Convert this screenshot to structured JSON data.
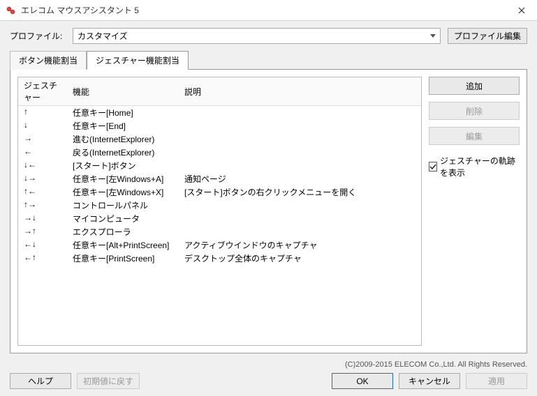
{
  "window": {
    "title": "エレコム マウスアシスタント 5"
  },
  "profile": {
    "label": "プロファイル:",
    "value": "カスタマイズ",
    "edit_button": "プロファイル編集"
  },
  "tabs": {
    "button_assign": "ボタン機能割当",
    "gesture_assign": "ジェスチャー機能割当"
  },
  "table": {
    "headers": {
      "gesture": "ジェスチャー",
      "function": "機能",
      "description": "説明"
    },
    "rows": [
      {
        "gesture": "↑",
        "function": "任意キー[Home]",
        "description": ""
      },
      {
        "gesture": "↓",
        "function": "任意キー[End]",
        "description": ""
      },
      {
        "gesture": "→",
        "function": "進む(InternetExplorer)",
        "description": ""
      },
      {
        "gesture": "←",
        "function": "戻る(InternetExplorer)",
        "description": ""
      },
      {
        "gesture": "↓←",
        "function": "[スタート]ボタン",
        "description": ""
      },
      {
        "gesture": "↓→",
        "function": "任意キー[左Windows+A]",
        "description": "通知ページ"
      },
      {
        "gesture": "↑←",
        "function": "任意キー[左Windows+X]",
        "description": "[スタート]ボタンの右クリックメニューを開く"
      },
      {
        "gesture": "↑→",
        "function": "コントロールパネル",
        "description": ""
      },
      {
        "gesture": "→↓",
        "function": "マイコンピュータ",
        "description": ""
      },
      {
        "gesture": "→↑",
        "function": "エクスプローラ",
        "description": ""
      },
      {
        "gesture": "←↓",
        "function": "任意キー[Alt+PrintScreen]",
        "description": "アクティブウインドウのキャプチャ"
      },
      {
        "gesture": "←↑",
        "function": "任意キー[PrintScreen]",
        "description": "デスクトップ全体のキャプチャ"
      }
    ]
  },
  "side": {
    "add": "追加",
    "delete": "削除",
    "edit": "編集",
    "trajectory_checkbox": "ジェスチャーの軌跡を表示"
  },
  "footer": {
    "copyright": "(C)2009-2015 ELECOM Co.,Ltd. All Rights Reserved.",
    "help": "ヘルプ",
    "reset": "初期値に戻す",
    "ok": "OK",
    "cancel": "キャンセル",
    "apply": "適用"
  }
}
